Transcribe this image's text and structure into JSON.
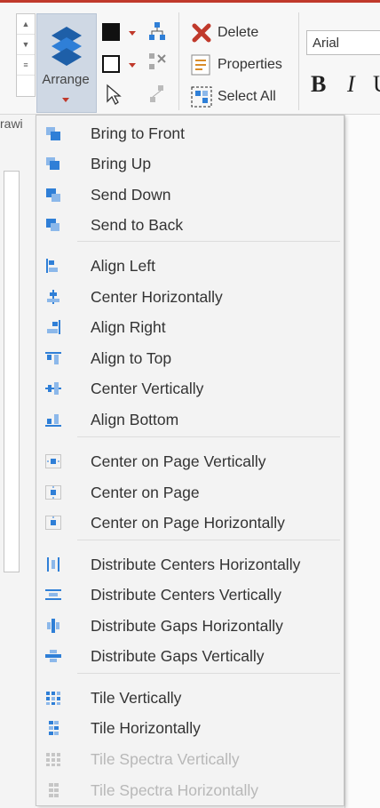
{
  "ribbon": {
    "arrange_label": "Arrange",
    "delete_label": "Delete",
    "properties_label": "Properties",
    "select_all_label": "Select All",
    "font_name": "Arial",
    "bold": "B",
    "italic": "I",
    "underline": "U",
    "left_panel_label": "rawi"
  },
  "menu": {
    "items": [
      {
        "label": "Bring to Front",
        "icon": "bring-to-front-icon",
        "enabled": true
      },
      {
        "label": "Bring Up",
        "icon": "bring-up-icon",
        "enabled": true
      },
      {
        "label": "Send Down",
        "icon": "send-down-icon",
        "enabled": true
      },
      {
        "label": "Send to Back",
        "icon": "send-to-back-icon",
        "enabled": true
      },
      {
        "label": "Align Left",
        "icon": "align-left-icon",
        "enabled": true
      },
      {
        "label": "Center Horizontally",
        "icon": "center-horizontally-icon",
        "enabled": true
      },
      {
        "label": "Align Right",
        "icon": "align-right-icon",
        "enabled": true
      },
      {
        "label": "Align to Top",
        "icon": "align-top-icon",
        "enabled": true
      },
      {
        "label": "Center Vertically",
        "icon": "center-vertically-icon",
        "enabled": true
      },
      {
        "label": "Align Bottom",
        "icon": "align-bottom-icon",
        "enabled": true
      },
      {
        "label": "Center on Page Vertically",
        "icon": "center-page-vertically-icon",
        "enabled": true
      },
      {
        "label": "Center on Page",
        "icon": "center-page-icon",
        "enabled": true
      },
      {
        "label": "Center on Page Horizontally",
        "icon": "center-page-horizontally-icon",
        "enabled": true
      },
      {
        "label": "Distribute Centers Horizontally",
        "icon": "distribute-centers-horizontally-icon",
        "enabled": true
      },
      {
        "label": "Distribute Centers Vertically",
        "icon": "distribute-centers-vertically-icon",
        "enabled": true
      },
      {
        "label": "Distribute Gaps Horizontally",
        "icon": "distribute-gaps-horizontally-icon",
        "enabled": true
      },
      {
        "label": "Distribute Gaps Vertically",
        "icon": "distribute-gaps-vertically-icon",
        "enabled": true
      },
      {
        "label": "Tile Vertically",
        "icon": "tile-vertically-icon",
        "enabled": true
      },
      {
        "label": "Tile Horizontally",
        "icon": "tile-horizontally-icon",
        "enabled": true
      },
      {
        "label": "Tile Spectra Vertically",
        "icon": "tile-spectra-vertically-icon",
        "enabled": false
      },
      {
        "label": "Tile Spectra Horizontally",
        "icon": "tile-spectra-horizontally-icon",
        "enabled": false
      }
    ]
  },
  "colors": {
    "accent_red": "#c0392b",
    "icon_blue": "#2f7fd7",
    "icon_light_blue": "#8cb8ea",
    "disabled_text": "#b8b8b8"
  }
}
